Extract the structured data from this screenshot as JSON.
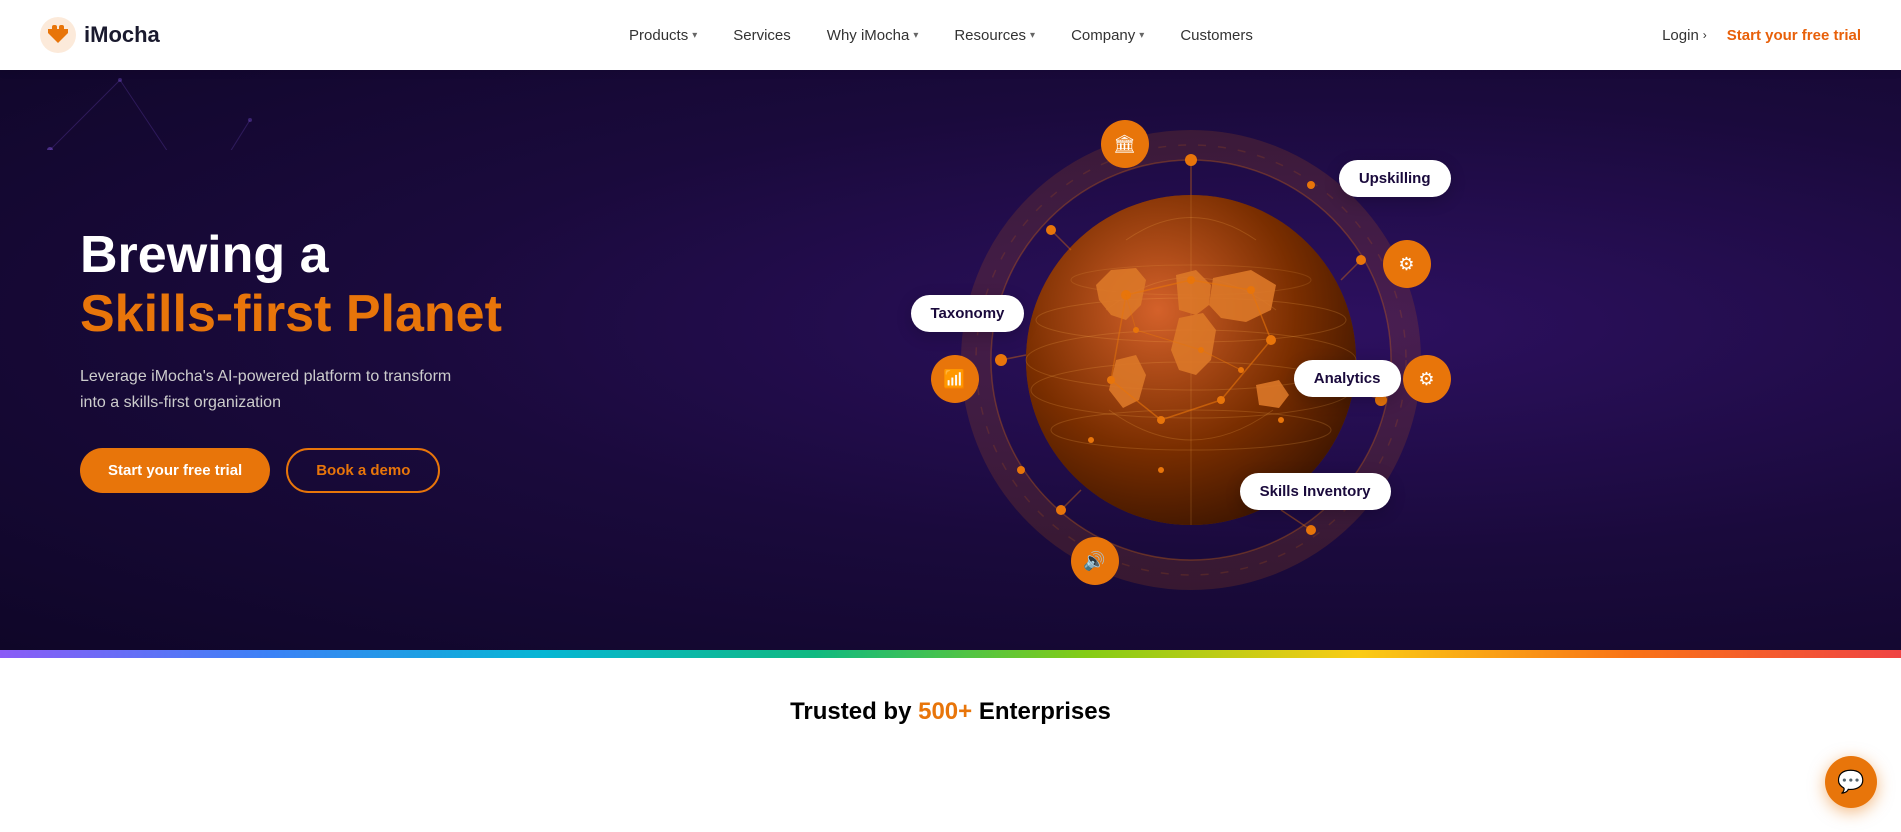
{
  "navbar": {
    "logo_text": "iMocha",
    "nav_items": [
      {
        "label": "Products",
        "has_dropdown": true
      },
      {
        "label": "Services",
        "has_dropdown": false
      },
      {
        "label": "Why iMocha",
        "has_dropdown": true
      },
      {
        "label": "Resources",
        "has_dropdown": true
      },
      {
        "label": "Company",
        "has_dropdown": true
      },
      {
        "label": "Customers",
        "has_dropdown": false
      }
    ],
    "login_label": "Login",
    "free_trial_label": "Start your free trial"
  },
  "hero": {
    "title_line1": "Brewing a",
    "title_line2": "Skills-first Planet",
    "subtitle": "Leverage iMocha's AI-powered platform to transform into a skills-first organization",
    "cta_primary": "Start your free trial",
    "cta_secondary": "Book a demo"
  },
  "globe": {
    "labels": {
      "upskilling": "Upskilling",
      "taxonomy": "Taxonomy",
      "analytics": "Analytics",
      "skills_inventory": "Skills Inventory"
    }
  },
  "trusted": {
    "text_before": "Trusted by ",
    "number": "500+",
    "text_after": " Enterprises"
  },
  "colors": {
    "accent": "#e8750a",
    "hero_bg": "#1a0a3c",
    "white": "#ffffff"
  }
}
